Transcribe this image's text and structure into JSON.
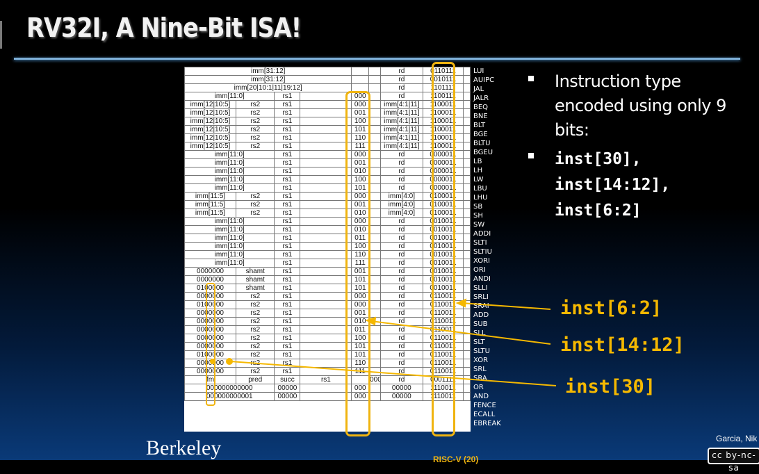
{
  "slide": {
    "title": "RV32I, A Nine-Bit ISA!",
    "bullets": [
      "Instruction type encoded using only 9 bits:"
    ],
    "code_bullet": [
      "inst[30],",
      "inst[14:12],",
      "inst[6:2]"
    ],
    "callouts": [
      "inst[6:2]",
      "inst[14:12]",
      "inst[30]"
    ],
    "footer_logo": "Berkeley",
    "footer_author": "Garcia, Nik",
    "license_badge": "cc by-nc-sa",
    "footnote": "RISC-V (20)"
  },
  "rows": [
    {
      "cells": [
        {
          "t": "imm[31:12]",
          "s": 4
        },
        {
          "t": ""
        },
        {
          "t": "rd"
        },
        {
          "t": "0110111"
        }
      ],
      "op": "LUI"
    },
    {
      "cells": [
        {
          "t": "imm[31:12]",
          "s": 4
        },
        {
          "t": ""
        },
        {
          "t": "rd"
        },
        {
          "t": "0010111"
        }
      ],
      "op": "AUIPC"
    },
    {
      "cells": [
        {
          "t": "imm[20|10:1|11|19:12]",
          "s": 4
        },
        {
          "t": ""
        },
        {
          "t": "rd"
        },
        {
          "t": "1101111"
        }
      ],
      "op": "JAL"
    },
    {
      "cells": [
        {
          "t": "imm[11:0]",
          "s": 2
        },
        {
          "t": "rs1"
        },
        {
          "t": ""
        },
        {
          "t": "000"
        },
        {
          "t": "rd"
        },
        {
          "t": "1100111"
        }
      ],
      "op": "JALR"
    },
    {
      "cells": [
        {
          "t": "imm[12|10:5]"
        },
        {
          "t": "rs2"
        },
        {
          "t": "rs1"
        },
        {
          "t": ""
        },
        {
          "t": "000"
        },
        {
          "t": "imm[4:1|11]"
        },
        {
          "t": "1100011"
        }
      ],
      "op": "BEQ"
    },
    {
      "cells": [
        {
          "t": "imm[12|10:5]"
        },
        {
          "t": "rs2"
        },
        {
          "t": "rs1"
        },
        {
          "t": ""
        },
        {
          "t": "001"
        },
        {
          "t": "imm[4:1|11]"
        },
        {
          "t": "1100011"
        }
      ],
      "op": "BNE"
    },
    {
      "cells": [
        {
          "t": "imm[12|10:5]"
        },
        {
          "t": "rs2"
        },
        {
          "t": "rs1"
        },
        {
          "t": ""
        },
        {
          "t": "100"
        },
        {
          "t": "imm[4:1|11]"
        },
        {
          "t": "1100011"
        }
      ],
      "op": "BLT"
    },
    {
      "cells": [
        {
          "t": "imm[12|10:5]"
        },
        {
          "t": "rs2"
        },
        {
          "t": "rs1"
        },
        {
          "t": ""
        },
        {
          "t": "101"
        },
        {
          "t": "imm[4:1|11]"
        },
        {
          "t": "1100011"
        }
      ],
      "op": "BGE"
    },
    {
      "cells": [
        {
          "t": "imm[12|10:5]"
        },
        {
          "t": "rs2"
        },
        {
          "t": "rs1"
        },
        {
          "t": ""
        },
        {
          "t": "110"
        },
        {
          "t": "imm[4:1|11]"
        },
        {
          "t": "1100011"
        }
      ],
      "op": "BLTU"
    },
    {
      "cells": [
        {
          "t": "imm[12|10:5]"
        },
        {
          "t": "rs2"
        },
        {
          "t": "rs1"
        },
        {
          "t": ""
        },
        {
          "t": "111"
        },
        {
          "t": "imm[4:1|11]"
        },
        {
          "t": "1100011"
        }
      ],
      "op": "BGEU"
    },
    {
      "cells": [
        {
          "t": "imm[11:0]",
          "s": 2
        },
        {
          "t": "rs1"
        },
        {
          "t": ""
        },
        {
          "t": "000"
        },
        {
          "t": "rd"
        },
        {
          "t": "0000011"
        }
      ],
      "op": "LB"
    },
    {
      "cells": [
        {
          "t": "imm[11:0]",
          "s": 2
        },
        {
          "t": "rs1"
        },
        {
          "t": ""
        },
        {
          "t": "001"
        },
        {
          "t": "rd"
        },
        {
          "t": "0000011"
        }
      ],
      "op": "LH"
    },
    {
      "cells": [
        {
          "t": "imm[11:0]",
          "s": 2
        },
        {
          "t": "rs1"
        },
        {
          "t": ""
        },
        {
          "t": "010"
        },
        {
          "t": "rd"
        },
        {
          "t": "0000011"
        }
      ],
      "op": "LW"
    },
    {
      "cells": [
        {
          "t": "imm[11:0]",
          "s": 2
        },
        {
          "t": "rs1"
        },
        {
          "t": ""
        },
        {
          "t": "100"
        },
        {
          "t": "rd"
        },
        {
          "t": "0000011"
        }
      ],
      "op": "LBU"
    },
    {
      "cells": [
        {
          "t": "imm[11:0]",
          "s": 2
        },
        {
          "t": "rs1"
        },
        {
          "t": ""
        },
        {
          "t": "101"
        },
        {
          "t": "rd"
        },
        {
          "t": "0000011"
        }
      ],
      "op": "LHU"
    },
    {
      "cells": [
        {
          "t": "imm[11:5]"
        },
        {
          "t": "rs2"
        },
        {
          "t": "rs1"
        },
        {
          "t": ""
        },
        {
          "t": "000"
        },
        {
          "t": "imm[4:0]"
        },
        {
          "t": "0100011"
        }
      ],
      "op": "SB"
    },
    {
      "cells": [
        {
          "t": "imm[11:5]"
        },
        {
          "t": "rs2"
        },
        {
          "t": "rs1"
        },
        {
          "t": ""
        },
        {
          "t": "001"
        },
        {
          "t": "imm[4:0]"
        },
        {
          "t": "0100011"
        }
      ],
      "op": "SH"
    },
    {
      "cells": [
        {
          "t": "imm[11:5]"
        },
        {
          "t": "rs2"
        },
        {
          "t": "rs1"
        },
        {
          "t": ""
        },
        {
          "t": "010"
        },
        {
          "t": "imm[4:0]"
        },
        {
          "t": "0100011"
        }
      ],
      "op": "SW"
    },
    {
      "cells": [
        {
          "t": "imm[11:0]",
          "s": 2
        },
        {
          "t": "rs1"
        },
        {
          "t": ""
        },
        {
          "t": "000"
        },
        {
          "t": "rd"
        },
        {
          "t": "0010011"
        }
      ],
      "op": "ADDI"
    },
    {
      "cells": [
        {
          "t": "imm[11:0]",
          "s": 2
        },
        {
          "t": "rs1"
        },
        {
          "t": ""
        },
        {
          "t": "010"
        },
        {
          "t": "rd"
        },
        {
          "t": "0010011"
        }
      ],
      "op": "SLTI"
    },
    {
      "cells": [
        {
          "t": "imm[11:0]",
          "s": 2
        },
        {
          "t": "rs1"
        },
        {
          "t": ""
        },
        {
          "t": "011"
        },
        {
          "t": "rd"
        },
        {
          "t": "0010011"
        }
      ],
      "op": "SLTIU"
    },
    {
      "cells": [
        {
          "t": "imm[11:0]",
          "s": 2
        },
        {
          "t": "rs1"
        },
        {
          "t": ""
        },
        {
          "t": "100"
        },
        {
          "t": "rd"
        },
        {
          "t": "0010011"
        }
      ],
      "op": "XORI"
    },
    {
      "cells": [
        {
          "t": "imm[11:0]",
          "s": 2
        },
        {
          "t": "rs1"
        },
        {
          "t": ""
        },
        {
          "t": "110"
        },
        {
          "t": "rd"
        },
        {
          "t": "0010011"
        }
      ],
      "op": "ORI"
    },
    {
      "cells": [
        {
          "t": "imm[11:0]",
          "s": 2
        },
        {
          "t": "rs1"
        },
        {
          "t": ""
        },
        {
          "t": "111"
        },
        {
          "t": "rd"
        },
        {
          "t": "0010011"
        }
      ],
      "op": "ANDI"
    },
    {
      "cells": [
        {
          "t": "0000000"
        },
        {
          "t": "shamt"
        },
        {
          "t": "rs1"
        },
        {
          "t": ""
        },
        {
          "t": "001"
        },
        {
          "t": "rd"
        },
        {
          "t": "0010011"
        }
      ],
      "op": "SLLI"
    },
    {
      "cells": [
        {
          "t": "0000000"
        },
        {
          "t": "shamt"
        },
        {
          "t": "rs1"
        },
        {
          "t": ""
        },
        {
          "t": "101"
        },
        {
          "t": "rd"
        },
        {
          "t": "0010011"
        }
      ],
      "op": "SRLI"
    },
    {
      "cells": [
        {
          "t": "0100000"
        },
        {
          "t": "shamt"
        },
        {
          "t": "rs1"
        },
        {
          "t": ""
        },
        {
          "t": "101"
        },
        {
          "t": "rd"
        },
        {
          "t": "0010011"
        }
      ],
      "op": "SRAI"
    },
    {
      "cells": [
        {
          "t": "0000000"
        },
        {
          "t": "rs2"
        },
        {
          "t": "rs1"
        },
        {
          "t": ""
        },
        {
          "t": "000"
        },
        {
          "t": "rd"
        },
        {
          "t": "0110011"
        }
      ],
      "op": "ADD"
    },
    {
      "cells": [
        {
          "t": "0100000"
        },
        {
          "t": "rs2"
        },
        {
          "t": "rs1"
        },
        {
          "t": ""
        },
        {
          "t": "000"
        },
        {
          "t": "rd"
        },
        {
          "t": "0110011"
        }
      ],
      "op": "SUB"
    },
    {
      "cells": [
        {
          "t": "0000000"
        },
        {
          "t": "rs2"
        },
        {
          "t": "rs1"
        },
        {
          "t": ""
        },
        {
          "t": "001"
        },
        {
          "t": "rd"
        },
        {
          "t": "0110011"
        }
      ],
      "op": "SLL"
    },
    {
      "cells": [
        {
          "t": "0000000"
        },
        {
          "t": "rs2"
        },
        {
          "t": "rs1"
        },
        {
          "t": ""
        },
        {
          "t": "010"
        },
        {
          "t": "rd"
        },
        {
          "t": "0110011"
        }
      ],
      "op": "SLT"
    },
    {
      "cells": [
        {
          "t": "0000000"
        },
        {
          "t": "rs2"
        },
        {
          "t": "rs1"
        },
        {
          "t": ""
        },
        {
          "t": "011"
        },
        {
          "t": "rd"
        },
        {
          "t": "0110011"
        }
      ],
      "op": "SLTU"
    },
    {
      "cells": [
        {
          "t": "0000000"
        },
        {
          "t": "rs2"
        },
        {
          "t": "rs1"
        },
        {
          "t": ""
        },
        {
          "t": "100"
        },
        {
          "t": "rd"
        },
        {
          "t": "0110011"
        }
      ],
      "op": "XOR"
    },
    {
      "cells": [
        {
          "t": "0000000"
        },
        {
          "t": "rs2"
        },
        {
          "t": "rs1"
        },
        {
          "t": ""
        },
        {
          "t": "101"
        },
        {
          "t": "rd"
        },
        {
          "t": "0110011"
        }
      ],
      "op": "SRL"
    },
    {
      "cells": [
        {
          "t": "0100000"
        },
        {
          "t": "rs2"
        },
        {
          "t": "rs1"
        },
        {
          "t": ""
        },
        {
          "t": "101"
        },
        {
          "t": "rd"
        },
        {
          "t": "0110011"
        }
      ],
      "op": "SRA"
    },
    {
      "cells": [
        {
          "t": "0000000"
        },
        {
          "t": "rs2"
        },
        {
          "t": "rs1"
        },
        {
          "t": ""
        },
        {
          "t": "110"
        },
        {
          "t": "rd"
        },
        {
          "t": "0110011"
        }
      ],
      "op": "OR"
    },
    {
      "cells": [
        {
          "t": "0000000"
        },
        {
          "t": "rs2"
        },
        {
          "t": "rs1"
        },
        {
          "t": ""
        },
        {
          "t": "111"
        },
        {
          "t": "rd"
        },
        {
          "t": "0110011"
        }
      ],
      "op": "AND"
    },
    {
      "cells": [
        {
          "t": "fm"
        },
        {
          "t": "pred"
        },
        {
          "t": "succ"
        },
        {
          "t": "rs1"
        },
        {
          "t": ""
        },
        {
          "t": "000"
        },
        {
          "t": "rd"
        },
        {
          "t": "0001111"
        }
      ],
      "op": "FENCE",
      "fence": true
    },
    {
      "cells": [
        {
          "t": "000000000000",
          "s": 2
        },
        {
          "t": "00000"
        },
        {
          "t": ""
        },
        {
          "t": "000"
        },
        {
          "t": "00000"
        },
        {
          "t": "1110011"
        }
      ],
      "op": "ECALL"
    },
    {
      "cells": [
        {
          "t": "000000000001",
          "s": 2
        },
        {
          "t": "00000"
        },
        {
          "t": ""
        },
        {
          "t": "000"
        },
        {
          "t": "00000"
        },
        {
          "t": "1110011"
        }
      ],
      "op": "EBREAK"
    }
  ],
  "colors": {
    "highlight": "#f0b410",
    "callout": "#f5b800",
    "rule": "#7fb0d8"
  }
}
